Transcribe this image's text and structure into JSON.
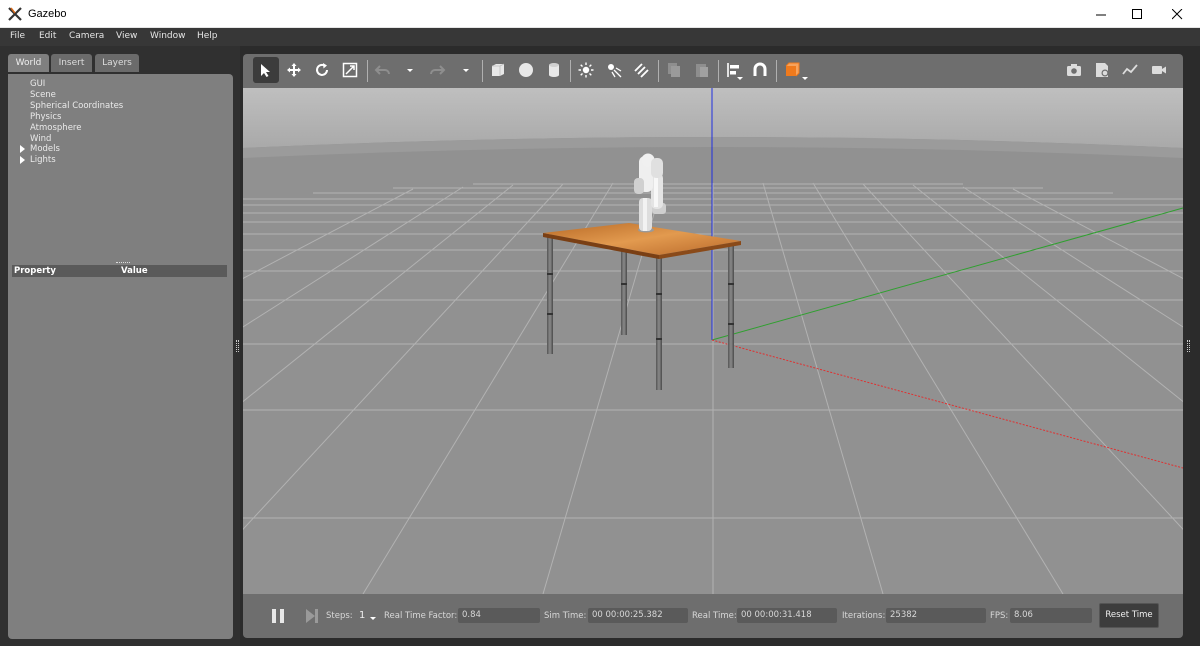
{
  "window": {
    "title": "Gazebo"
  },
  "menu": [
    "File",
    "Edit",
    "Camera",
    "View",
    "Window",
    "Help"
  ],
  "left_panel": {
    "tabs": [
      "World",
      "Insert",
      "Layers"
    ],
    "active_tab": "World",
    "tree": [
      {
        "label": "GUI",
        "expandable": false
      },
      {
        "label": "Scene",
        "expandable": false
      },
      {
        "label": "Spherical Coordinates",
        "expandable": false
      },
      {
        "label": "Physics",
        "expandable": false
      },
      {
        "label": "Atmosphere",
        "expandable": false
      },
      {
        "label": "Wind",
        "expandable": false
      },
      {
        "label": "Models",
        "expandable": true
      },
      {
        "label": "Lights",
        "expandable": true
      }
    ],
    "property_table": {
      "col_property": "Property",
      "col_value": "Value"
    }
  },
  "toolbar": {
    "left_icons": [
      "select-arrow-icon",
      "translate-icon",
      "rotate-icon",
      "scale-icon",
      "undo-icon",
      "redo-icon",
      "box-icon",
      "sphere-icon",
      "cylinder-icon",
      "point-light-icon",
      "spot-light-icon",
      "directional-light-icon",
      "copy-icon",
      "paste-icon",
      "align-icon",
      "snap-icon",
      "view-angle-icon"
    ],
    "right_icons": [
      "screenshot-icon",
      "log-icon",
      "plot-icon",
      "record-icon"
    ],
    "active_tool": "select-arrow-icon",
    "accent_color": "#f07a1c"
  },
  "bottom_bar": {
    "steps_label": "Steps:",
    "steps_value": "1",
    "rtf_label": "Real Time Factor:",
    "rtf_value": "0.84",
    "sim_time_label": "Sim Time:",
    "sim_time_value": "00 00:00:25.382",
    "real_time_label": "Real Time:",
    "real_time_value": "00 00:00:31.418",
    "iterations_label": "Iterations:",
    "iterations_value": "25382",
    "fps_label": "FPS:",
    "fps_value": "8.06",
    "reset_label": "Reset Time"
  },
  "scene_colors": {
    "sky": "#b4b4b4",
    "ground": "#8f8f8f",
    "table_top": "#c9772e",
    "axis_x": "#e03030",
    "axis_y": "#2fa02f",
    "axis_z": "#2030e0"
  }
}
